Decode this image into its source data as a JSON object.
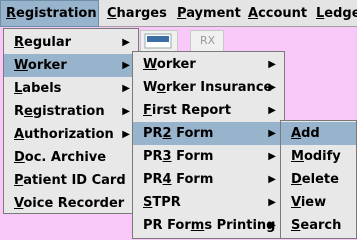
{
  "menubar": [
    {
      "pre": "",
      "ul": "R",
      "post": "egistration"
    },
    {
      "pre": "",
      "ul": "C",
      "post": "harges"
    },
    {
      "pre": "",
      "ul": "P",
      "post": "ayment"
    },
    {
      "pre": "",
      "ul": "A",
      "post": "ccount"
    },
    {
      "pre": "",
      "ul": "L",
      "post": "edge"
    }
  ],
  "toolbar": {
    "rx_label": "RX"
  },
  "registration_menu": [
    {
      "pre": "",
      "ul": "R",
      "post": "egular",
      "arrow": "▶"
    },
    {
      "pre": "",
      "ul": "W",
      "post": "orker",
      "arrow": "▶"
    },
    {
      "pre": "",
      "ul": "L",
      "post": "abels",
      "arrow": "▶"
    },
    {
      "pre": "R",
      "ul": "e",
      "post": "gistration",
      "arrow": "▶"
    },
    {
      "pre": "",
      "ul": "A",
      "post": "uthorization",
      "arrow": "▶"
    },
    {
      "pre": "",
      "ul": "D",
      "post": "oc. Archive",
      "arrow": ""
    },
    {
      "pre": "",
      "ul": "P",
      "post": "atient ID Card",
      "arrow": ""
    },
    {
      "pre": "",
      "ul": "V",
      "post": "oice Recorder",
      "arrow": ""
    }
  ],
  "worker_menu": [
    {
      "pre": "",
      "ul": "W",
      "post": "orker",
      "arrow": "▶"
    },
    {
      "pre": "W",
      "ul": "o",
      "post": "rker Insurance",
      "arrow": "▶"
    },
    {
      "pre": "",
      "ul": "F",
      "post": "irst Report",
      "arrow": "▶"
    },
    {
      "pre": "PR",
      "ul": "2",
      "post": " Form",
      "arrow": "▶"
    },
    {
      "pre": "PR",
      "ul": "3",
      "post": " Form",
      "arrow": "▶"
    },
    {
      "pre": "PR",
      "ul": "4",
      "post": " Form",
      "arrow": "▶"
    },
    {
      "pre": "",
      "ul": "S",
      "post": "TPR",
      "arrow": "▶"
    },
    {
      "pre": "PR For",
      "ul": "m",
      "post": "s Printing",
      "arrow": "▶"
    }
  ],
  "pr2_menu": [
    {
      "pre": "",
      "ul": "A",
      "post": "dd",
      "arrow": ""
    },
    {
      "pre": "",
      "ul": "M",
      "post": "odify",
      "arrow": ""
    },
    {
      "pre": "",
      "ul": "D",
      "post": "elete",
      "arrow": ""
    },
    {
      "pre": "",
      "ul": "V",
      "post": "iew",
      "arrow": ""
    },
    {
      "pre": "",
      "ul": "S",
      "post": "earch",
      "arrow": ""
    }
  ]
}
